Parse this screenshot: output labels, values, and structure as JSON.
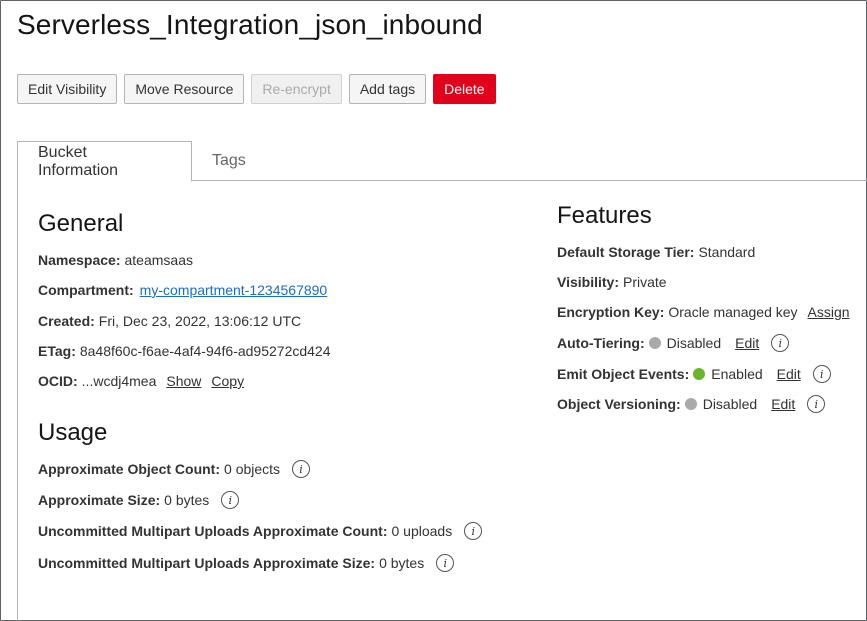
{
  "header": {
    "title": "Serverless_Integration_json_inbound"
  },
  "toolbar": {
    "edit_visibility": "Edit Visibility",
    "move_resource": "Move Resource",
    "reencrypt": "Re-encrypt",
    "add_tags": "Add tags",
    "delete": "Delete"
  },
  "tabs": {
    "bucket_information": "Bucket Information",
    "tags": "Tags"
  },
  "general": {
    "title": "General",
    "namespace_label": "Namespace:",
    "namespace_value": "ateamsaas",
    "compartment_label": "Compartment:",
    "compartment_value": "my-compartment-1234567890",
    "created_label": "Created:",
    "created_value": "Fri, Dec 23, 2022, 13:06:12 UTC",
    "etag_label": "ETag:",
    "etag_value": "8a48f60c-f6ae-4af4-94f6-ad95272cd424",
    "ocid_label": "OCID:",
    "ocid_value": "...wcdj4mea",
    "show_link": "Show",
    "copy_link": "Copy"
  },
  "usage": {
    "title": "Usage",
    "object_count_label": "Approximate Object Count:",
    "object_count_value": "0 objects",
    "size_label": "Approximate Size:",
    "size_value": "0 bytes",
    "multipart_count_label": "Uncommitted Multipart Uploads Approximate Count:",
    "multipart_count_value": "0 uploads",
    "multipart_size_label": "Uncommitted Multipart Uploads Approximate Size:",
    "multipart_size_value": "0 bytes"
  },
  "features": {
    "title": "Features",
    "storage_tier_label": "Default Storage Tier:",
    "storage_tier_value": "Standard",
    "visibility_label": "Visibility:",
    "visibility_value": "Private",
    "encryption_label": "Encryption Key:",
    "encryption_value": "Oracle managed key",
    "assign_link": "Assign",
    "auto_tiering_label": "Auto-Tiering:",
    "auto_tiering_value": "Disabled",
    "emit_events_label": "Emit Object Events:",
    "emit_events_value": "Enabled",
    "versioning_label": "Object Versioning:",
    "versioning_value": "Disabled",
    "edit_link": "Edit"
  },
  "colors": {
    "delete_button": "#e2001a",
    "enabled_dot": "#6bb52b",
    "disabled_dot": "#aaaaaa",
    "link_blue": "#1a6ec1"
  },
  "icons": {
    "info": "info-icon",
    "status": "status-dot"
  }
}
